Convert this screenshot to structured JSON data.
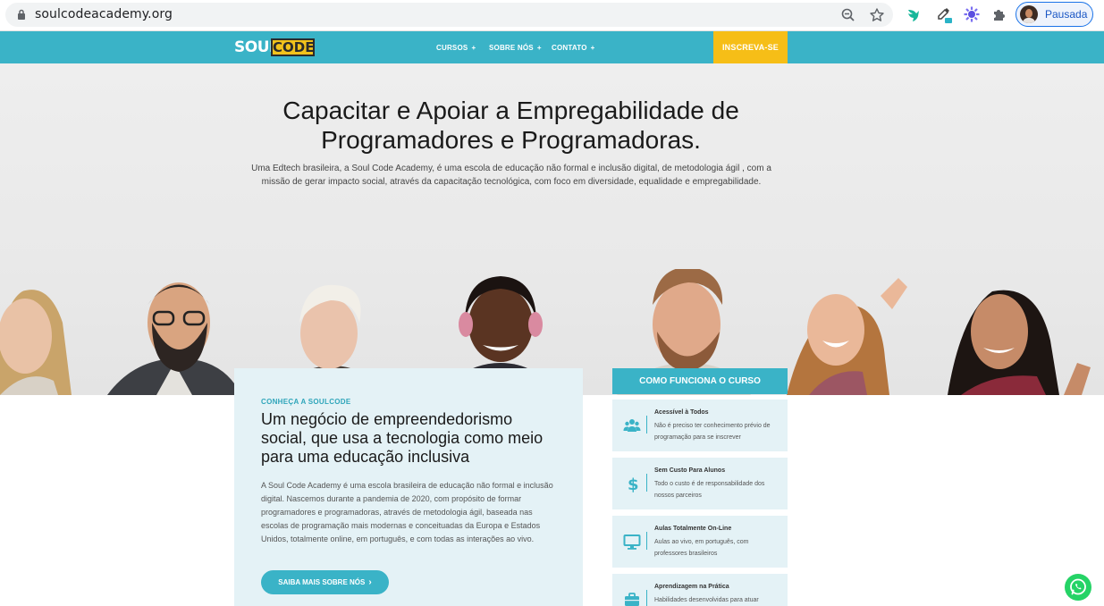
{
  "browser": {
    "url": "soulcodeacademy.org",
    "profile_label": "Pausada",
    "toolbar_icons": [
      "zoom-out-icon",
      "bookmark-star-icon"
    ],
    "extensions": [
      "teal-bird-extension-icon",
      "eyedropper-extension-icon",
      "purple-gear-extension-icon",
      "puzzle-extensions-icon"
    ]
  },
  "nav": {
    "logo_soul": "SOUL",
    "logo_code": "CODE",
    "items": [
      {
        "label": "CURSOS"
      },
      {
        "label": "SOBRE NÓS"
      },
      {
        "label": "CONTATO"
      }
    ],
    "plus": "+",
    "cta": "INSCREVA-SE",
    "colors": {
      "bar": "#3ab3c7",
      "cta": "#f6be17"
    }
  },
  "hero": {
    "title_line1": "Capacitar e Apoiar a Empregabilidade de",
    "title_line2": "Programadores e Programadoras.",
    "subtitle_line1": "Uma Edtech brasileira, a Soul Code Academy, é uma escola de educação não formal e inclusão digital, de metodologia ágil , com a",
    "subtitle_line2": "missão de gerar impacto social, através da capacitação tecnológica, com foco em diversidade, equalidade e empregabilidade."
  },
  "about": {
    "eyebrow": "CONHEÇA A SOULCODE",
    "title_line1": "Um negócio de empreendedorismo",
    "title_line2": "social, que usa a tecnologia como meio",
    "title_line3": "para uma educação inclusiva",
    "body": "A Soul Code Academy é uma escola brasileira de educação não formal e inclusão digital. Nascemos durante a pandemia de 2020, com propósito de formar programadores e programadoras, através de metodologia ágil, baseada nas escolas de programação mais modernas e conceituadas da Europa e Estados Unidos, totalmente online, em português, e com todas as interações ao vivo.",
    "button": "SAIBA MAIS SOBRE NÓS",
    "button_arrow": "›"
  },
  "how": {
    "header": "COMO FUNCIONA O CURSO",
    "features": [
      {
        "title": "Acessível à Todos",
        "desc": "Não é preciso ter conhecimento prévio de programação para se inscrever",
        "icon": "users-icon"
      },
      {
        "title": "Sem Custo Para Alunos",
        "desc": "Todo o custo é de responsabilidade dos nossos parceiros",
        "icon": "dollar-icon"
      },
      {
        "title": "Aulas Totalmente On-Line",
        "desc": "Aulas ao vivo, em português, com professores brasileiros",
        "icon": "monitor-icon"
      },
      {
        "title": "Aprendizagem na Prática",
        "desc": "Habilidades desenvolvidas para atuar",
        "icon": "briefcase-icon"
      }
    ]
  },
  "whatsapp": {
    "icon": "whatsapp-icon",
    "color": "#25d366"
  }
}
